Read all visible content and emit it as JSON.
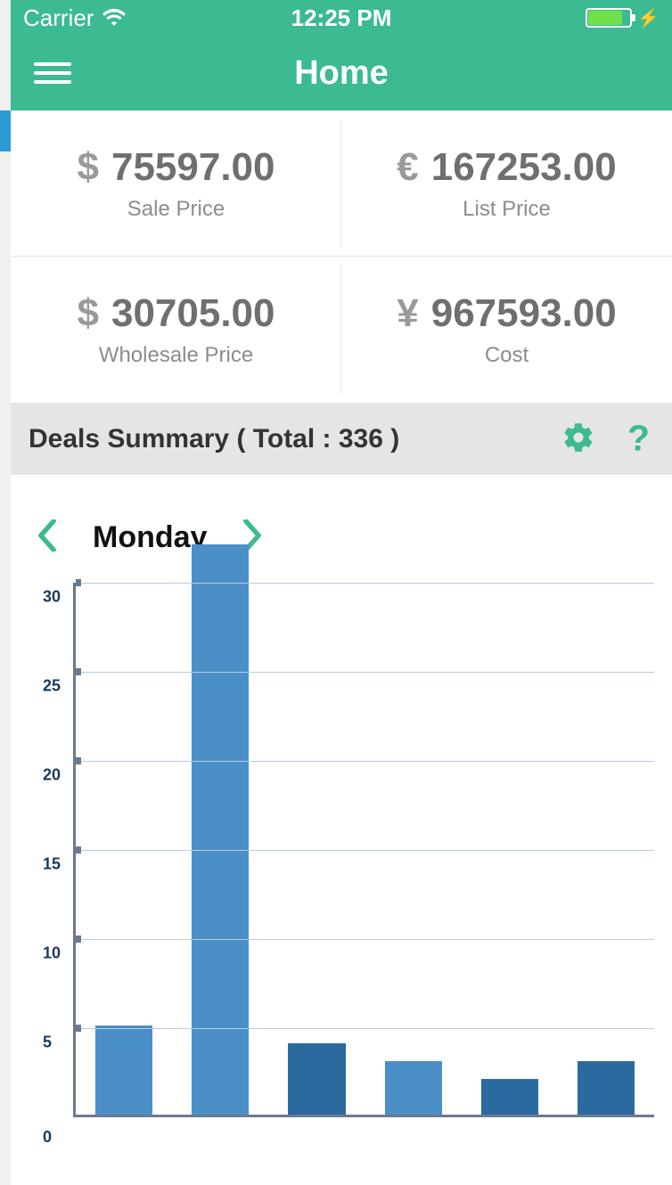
{
  "status": {
    "carrier": "Carrier",
    "time": "12:25 PM"
  },
  "nav": {
    "title": "Home"
  },
  "metrics": [
    {
      "currency": "$",
      "value": "75597.00",
      "label": "Sale Price"
    },
    {
      "currency": "€",
      "value": "167253.00",
      "label": "List Price"
    },
    {
      "currency": "$",
      "value": "30705.00",
      "label": "Wholesale Price"
    },
    {
      "currency": "¥",
      "value": "967593.00",
      "label": "Cost"
    }
  ],
  "deals": {
    "title": "Deals Summary ( Total :  336 )"
  },
  "day": {
    "label": "Monday"
  },
  "chart_data": {
    "type": "bar",
    "title": "",
    "xlabel": "",
    "ylabel": "",
    "ylim": [
      0,
      30
    ],
    "y_ticks": [
      0,
      5,
      10,
      15,
      20,
      25,
      30
    ],
    "categories": [
      "",
      "",
      "",
      "",
      "",
      ""
    ],
    "values": [
      5,
      32,
      4,
      3,
      2,
      3
    ],
    "bar_colors": [
      "#4a8fc7",
      "#4a8fc7",
      "#2b6a9e",
      "#4a8fc7",
      "#2b6a9e",
      "#2b6a9e"
    ]
  },
  "colors": {
    "accent": "#3cba92",
    "bar_light": "#4a8fc7",
    "bar_dark": "#2b6a9e"
  }
}
